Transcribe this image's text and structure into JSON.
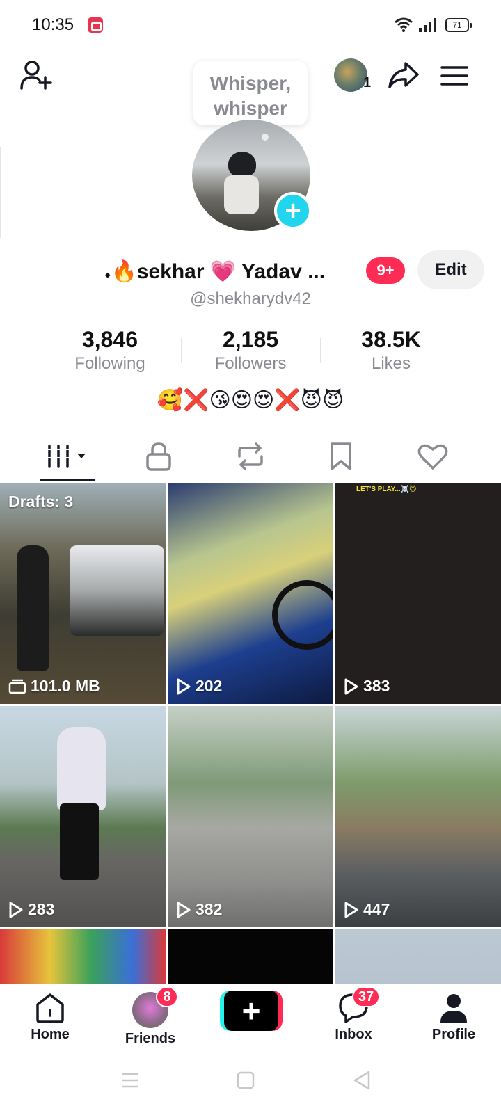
{
  "status_bar": {
    "time": "10:35",
    "battery": "71"
  },
  "header": {
    "followers_avatar_count": "1",
    "icons": [
      "add-user-icon",
      "share-icon",
      "menu-icon"
    ]
  },
  "profile": {
    "bubble_line1": "Whisper,",
    "bubble_line2": "whisper",
    "display_name": "𝆺🔥sekhar 💗 Yadav ...",
    "notification_badge": "9+",
    "edit_label": "Edit",
    "username": "@shekharydv42",
    "stats": [
      {
        "value": "3,846",
        "label": "Following"
      },
      {
        "value": "2,185",
        "label": "Followers"
      },
      {
        "value": "38.5K",
        "label": "Likes"
      }
    ],
    "bio": "🥰❌😘😍😍❌😈😈"
  },
  "tabs": [
    "videos-tab",
    "private-tab",
    "reposts-tab",
    "favorites-tab",
    "liked-tab"
  ],
  "grid": {
    "drafts_label": "Drafts: 3",
    "items": [
      {
        "count": "101.0 MB",
        "type": "draft"
      },
      {
        "count": "202",
        "type": "video"
      },
      {
        "count": "383",
        "type": "video",
        "overlay": "LET'S PLAY...☠️😈"
      },
      {
        "count": "283",
        "type": "video"
      },
      {
        "count": "382",
        "type": "video"
      },
      {
        "count": "447",
        "type": "video"
      }
    ]
  },
  "bottom_nav": {
    "home": "Home",
    "friends": "Friends",
    "friends_badge": "8",
    "inbox": "Inbox",
    "inbox_badge": "37",
    "profile": "Profile"
  },
  "colors": {
    "accent": "#fe2c55",
    "cyan": "#25f4ee",
    "text": "#161823",
    "muted": "#8a8b91"
  }
}
